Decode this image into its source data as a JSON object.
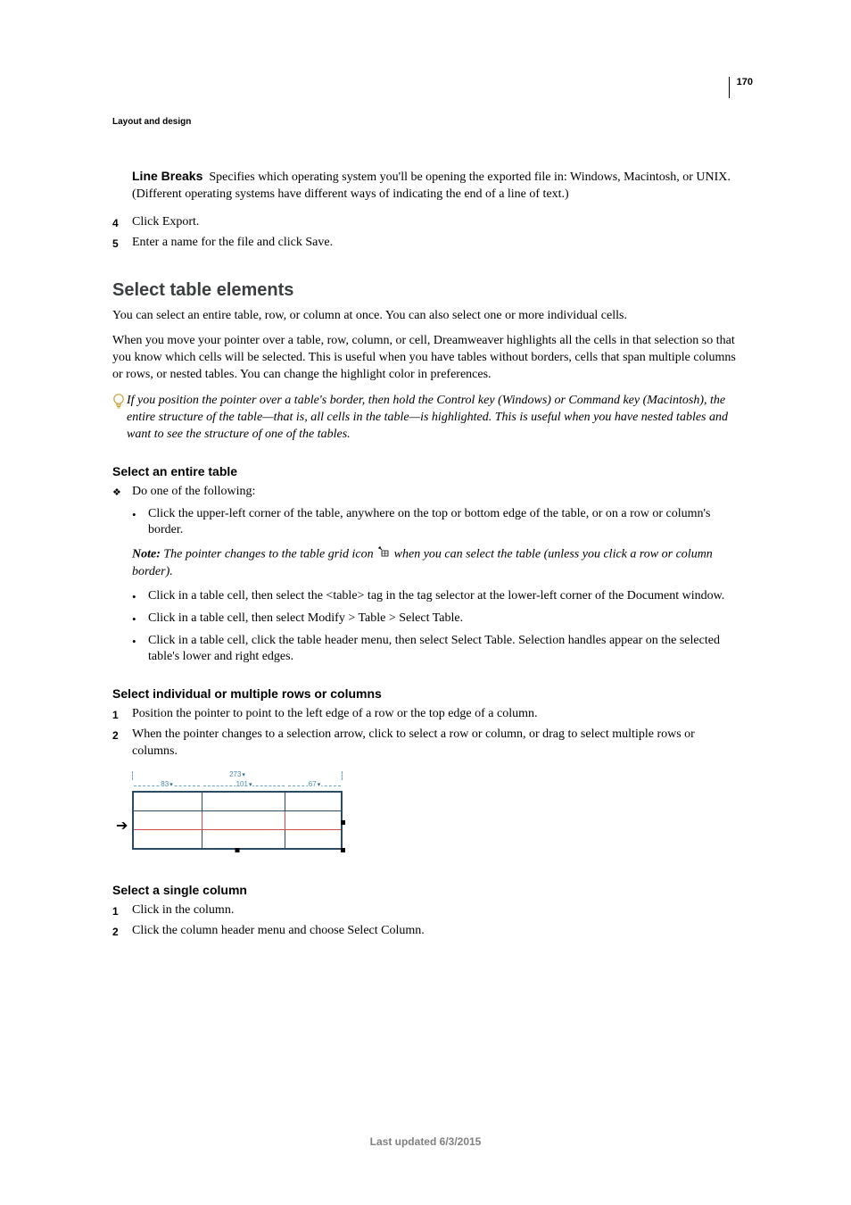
{
  "page_number": "170",
  "running_head": "Layout and design",
  "intro": {
    "line_breaks_label": "Line Breaks",
    "line_breaks_text": "Specifies which operating system you'll be opening the exported file in: Windows, Macintosh, or UNIX. (Different operating systems have different ways of indicating the end of a line of text.)",
    "step4_num": "4",
    "step4_text": "Click Export.",
    "step5_num": "5",
    "step5_text": "Enter a name for the file and click Save."
  },
  "section1": {
    "title": "Select table elements",
    "p1": "You can select an entire table, row, or column at once. You can also select one or more individual cells.",
    "p2": "When you move your pointer over a table, row, column, or cell, Dreamweaver highlights all the cells in that selection so that you know which cells will be selected. This is useful when you have tables without borders, cells that span multiple columns or rows, or nested tables. You can change the highlight color in preferences.",
    "tip": "If you position the pointer over a table's border, then hold the Control key (Windows) or Command key (Macintosh), the entire structure of the table—that is, all cells in the table—is highlighted. This is useful when you have nested tables and want to see the structure of one of the tables."
  },
  "sub1": {
    "title": "Select an entire table",
    "lead": "Do one of the following:",
    "b1": "Click the upper-left corner of the table, anywhere on the top or bottom edge of the table, or on a row or column's border.",
    "note_label": "Note:",
    "note_a": "The pointer changes to the table grid icon",
    "note_b": "when you can select the table (unless you click a row or column border).",
    "b2": "Click in a table cell, then select the <table> tag in the tag selector at the lower-left corner of the Document window.",
    "b3": "Click in a table cell, then select Modify > Table > Select Table.",
    "b4": "Click in a table cell, click the table header menu, then select Select Table. Selection handles appear on the selected table's lower and right edges."
  },
  "sub2": {
    "title": "Select individual or multiple rows or columns",
    "s1_num": "1",
    "s1": "Position the pointer to point to the left edge of a row or the top edge of a column.",
    "s2_num": "2",
    "s2": "When the pointer changes to a selection arrow, click to select a row or column, or drag to select multiple rows or columns.",
    "ruler_total": "273",
    "ruler_c1": "83",
    "ruler_c2": "101",
    "ruler_c3": "67"
  },
  "sub3": {
    "title": "Select a single column",
    "s1_num": "1",
    "s1": "Click in the column.",
    "s2_num": "2",
    "s2": "Click the column header menu and choose Select Column."
  },
  "footer": "Last updated 6/3/2015"
}
